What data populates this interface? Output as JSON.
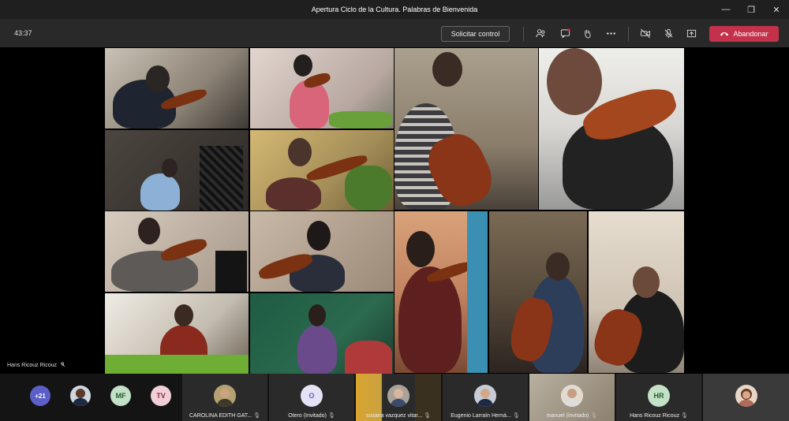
{
  "window": {
    "title": "Apertura Ciclo de la Cultura. Palabras de Bienvenida",
    "minimize": "—",
    "maximize": "❐",
    "close": "✕"
  },
  "toolbar": {
    "timer": "43:37",
    "request_control": "Solicitar control",
    "leave_label": "Abandonar",
    "icons": [
      "participants-icon",
      "chat-icon",
      "raise-hand-icon",
      "more-icon",
      "camera-off-icon",
      "mic-off-icon",
      "share-icon"
    ]
  },
  "speaker": {
    "name": "Hans Ricouz Ricouz"
  },
  "tray": {
    "overflow": "+21",
    "initials": [
      "MF",
      "TV"
    ],
    "participants": [
      {
        "name": "CAROLINA EDITH GAT..."
      },
      {
        "name": "Otero (Invitado)",
        "initials": "O"
      },
      {
        "name": "susana vazquez vitar..."
      },
      {
        "name": "Eugenio Larraín Herná..."
      },
      {
        "name": "manuel (invitado)"
      },
      {
        "name": "Hans Ricouz Ricouz",
        "initials": "HR"
      }
    ]
  },
  "colors": {
    "leave": "#c4314b",
    "accent": "#6264a7"
  }
}
